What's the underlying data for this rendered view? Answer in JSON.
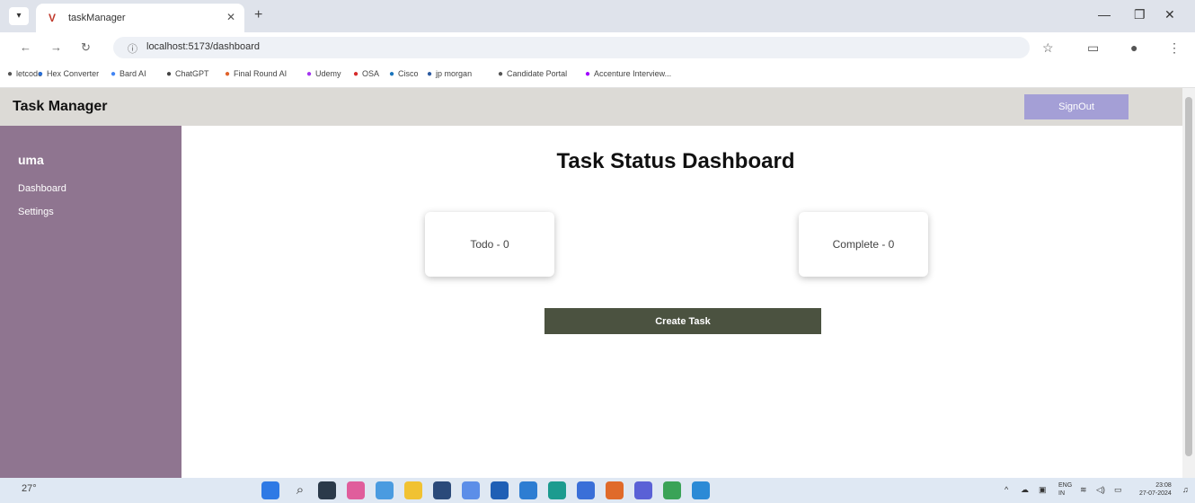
{
  "browser": {
    "tab_title": "taskManager",
    "url": "localhost:5173/dashboard",
    "bookmarks": [
      {
        "label": "letcode",
        "icon": "letcode-icon",
        "color": "#555555"
      },
      {
        "label": "Hex Converter",
        "icon": "hex-converter-icon",
        "color": "#2a6fd6"
      },
      {
        "label": "Bard AI",
        "icon": "bard-icon",
        "color": "#4285f4"
      },
      {
        "label": "ChatGPT",
        "icon": "chatgpt-icon",
        "color": "#444444"
      },
      {
        "label": "Final Round AI",
        "icon": "final-round-icon",
        "color": "#e0622a"
      },
      {
        "label": "Udemy",
        "icon": "udemy-icon",
        "color": "#a435f0"
      },
      {
        "label": "OSA",
        "icon": "osa-icon",
        "color": "#d62b2b"
      },
      {
        "label": "Cisco",
        "icon": "cisco-icon",
        "color": "#1b75bc"
      },
      {
        "label": "jp morgan",
        "icon": "jpmorgan-icon",
        "color": "#2c5aa0"
      },
      {
        "label": "Candidate Portal",
        "icon": "candidate-portal-icon",
        "color": "#555555"
      },
      {
        "label": "Accenture Interview...",
        "icon": "accenture-icon",
        "color": "#a100ff"
      }
    ]
  },
  "app": {
    "title": "Task Manager",
    "signout_label": "SignOut",
    "colors": {
      "header_bg": "#dcdad6",
      "sidebar_bg": "#8f7590",
      "signout_bg": "#a49fd6",
      "create_btn_bg": "#4b5240"
    },
    "sidebar": {
      "user_name": "uma",
      "links": [
        "Dashboard",
        "Settings"
      ]
    },
    "main": {
      "heading": "Task Status Dashboard",
      "cards": {
        "todo": "Todo - 0",
        "complete": "Complete - 0"
      },
      "create_task_label": "Create Task"
    }
  },
  "taskbar": {
    "weather": "27°",
    "language": "ENG\nIN",
    "time": "23:08",
    "date": "27-07-2024"
  }
}
